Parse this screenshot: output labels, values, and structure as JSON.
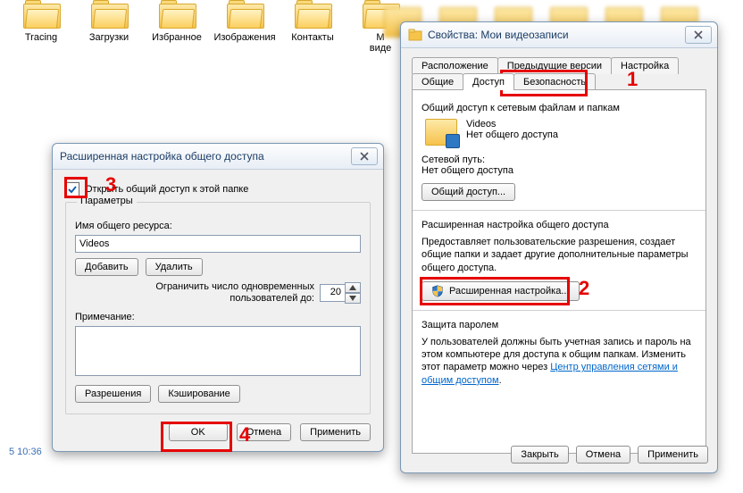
{
  "desktop": {
    "folders": [
      "Tracing",
      "Загрузки",
      "Избранное",
      "Изображения",
      "Контакты"
    ],
    "partial_folder_top": "М",
    "partial_folder_bottom": "виде",
    "timestamp": "5 10:36"
  },
  "props": {
    "title": "Свойства: Мои видеозаписи",
    "tabs_row1": [
      "Расположение",
      "Предыдущие версии",
      "Настройка"
    ],
    "tabs_row2": [
      "Общие",
      "Доступ",
      "Безопасность"
    ],
    "active_tab": "Доступ",
    "share_section": "Общий доступ к сетевым файлам и папкам",
    "share_name": "Videos",
    "share_state": "Нет общего доступа",
    "netpath_label": "Сетевой путь:",
    "netpath_value": "Нет общего доступа",
    "share_btn": "Общий доступ...",
    "adv_title": "Расширенная настройка общего доступа",
    "adv_desc": "Предоставляет пользовательские разрешения, создает общие папки и задает другие дополнительные параметры общего доступа.",
    "adv_btn": "Расширенная настройка...",
    "pwd_title": "Защита паролем",
    "pwd_desc": "У пользователей должны быть учетная запись и пароль на этом компьютере для доступа к общим папкам. Изменить этот параметр можно через ",
    "pwd_link": "Центр управления сетями и общим доступом",
    "btn_close": "Закрыть",
    "btn_cancel": "Отмена",
    "btn_apply": "Применить"
  },
  "adv": {
    "title": "Расширенная настройка общего доступа",
    "chk_label": "Открыть общий доступ к этой папке",
    "group_legend": "Параметры",
    "share_name_label": "Имя общего ресурса:",
    "share_name_value": "Videos",
    "btn_add": "Добавить",
    "btn_remove": "Удалить",
    "limit_label_a": "Ограничить число одновременных",
    "limit_label_b": "пользователей до:",
    "limit_value": "20",
    "note_label": "Примечание:",
    "btn_perm": "Разрешения",
    "btn_cache": "Кэширование",
    "btn_ok": "OK",
    "btn_cancel": "Отмена",
    "btn_apply": "Применить"
  },
  "anno": {
    "n1": "1",
    "n2": "2",
    "n3": "3",
    "n4": "4"
  }
}
